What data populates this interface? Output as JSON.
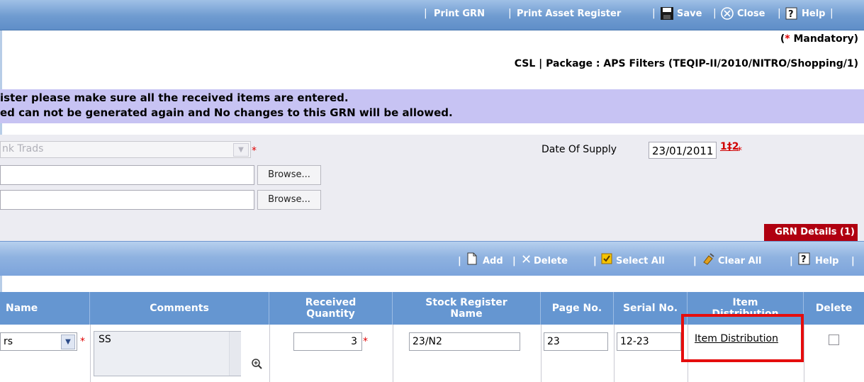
{
  "toolbar": {
    "print_grn": "Print GRN",
    "print_asset_register": "Print Asset Register",
    "save": "Save",
    "close": "Close",
    "help": "Help"
  },
  "header": {
    "mandatory": "Mandatory)",
    "mandatory_star": "*",
    "mandatory_open": "(",
    "package_info": "CSL | Package : APS Filters (TEQIP-II/2010/NITRO/Shopping/1)"
  },
  "notice": {
    "line1": "ister please make sure all the received items are entered.",
    "line2": "ed can not be generated again and No changes to this GRN will be allowed."
  },
  "form": {
    "supplier_value": "nk Trads",
    "browse1": "Browse...",
    "browse2": "Browse...",
    "date_of_supply_label": "Date Of Supply",
    "date_of_supply_value": "23/01/2011",
    "calendar_icon_text": "1‡2",
    "required_star": "*"
  },
  "tabs": {
    "grn_details": "GRN Details (1)"
  },
  "grid_toolbar": {
    "add": "Add",
    "delete": "Delete",
    "select_all": "Select All",
    "clear_all": "Clear All",
    "help": "Help"
  },
  "table": {
    "headers": {
      "name": "Name",
      "comments": "Comments",
      "received_quantity_1": "Received",
      "received_quantity_2": "Quantity",
      "stock_register_1": "Stock Register",
      "stock_register_2": "Name",
      "page_no": "Page No.",
      "serial_no": "Serial No.",
      "item_distribution_1": "Item",
      "item_distribution_2": "Distribution",
      "delete": "Delete"
    },
    "row": {
      "name_value": "rs",
      "comments": "SS",
      "received_quantity": "3",
      "stock_register_name": "23/N2",
      "page_no": "23",
      "serial_no": "12-23",
      "item_distribution_link": "Item Distribution"
    }
  },
  "colors": {
    "accent_blue": "#6596d1",
    "notice_bg": "#c7c3f3",
    "tab_red": "#b00010",
    "highlight": "#e50d0d"
  }
}
